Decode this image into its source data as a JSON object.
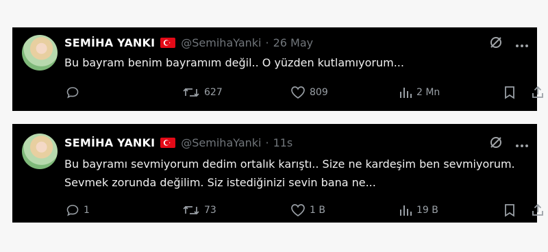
{
  "tweets": [
    {
      "name": "SEMİHA YANKI",
      "handle": "@SemihaYanki",
      "separator": "·",
      "time": "26 May",
      "text": "Bu bayram benim bayramım değil.. O yüzden kutlamıyorum...",
      "replies": "",
      "retweets": "627",
      "likes": "809",
      "views": "2 Mn"
    },
    {
      "name": "SEMİHA YANKI",
      "handle": "@SemihaYanki",
      "separator": "·",
      "time": "11s",
      "text": "Bu bayramı sevmiyorum dedim ortalık karıştı.. Size ne kardeşim ben sevmiyorum. Sevmek zorunda değilim. Siz istediğinizi sevin bana ne...",
      "replies": "1",
      "retweets": "73",
      "likes": "1 B",
      "views": "19 B"
    }
  ],
  "icons": {
    "flag": "turkey-flag-icon",
    "grok": "grok-icon",
    "more": "more-icon",
    "reply": "reply-icon",
    "retweet": "retweet-icon",
    "like": "heart-icon",
    "views": "views-chart-icon",
    "bookmark": "bookmark-icon",
    "share": "share-icon"
  },
  "colors": {
    "card_bg": "#000000",
    "page_bg": "#f7f7f7",
    "muted": "#71767b",
    "flag_red": "#e30a17"
  }
}
